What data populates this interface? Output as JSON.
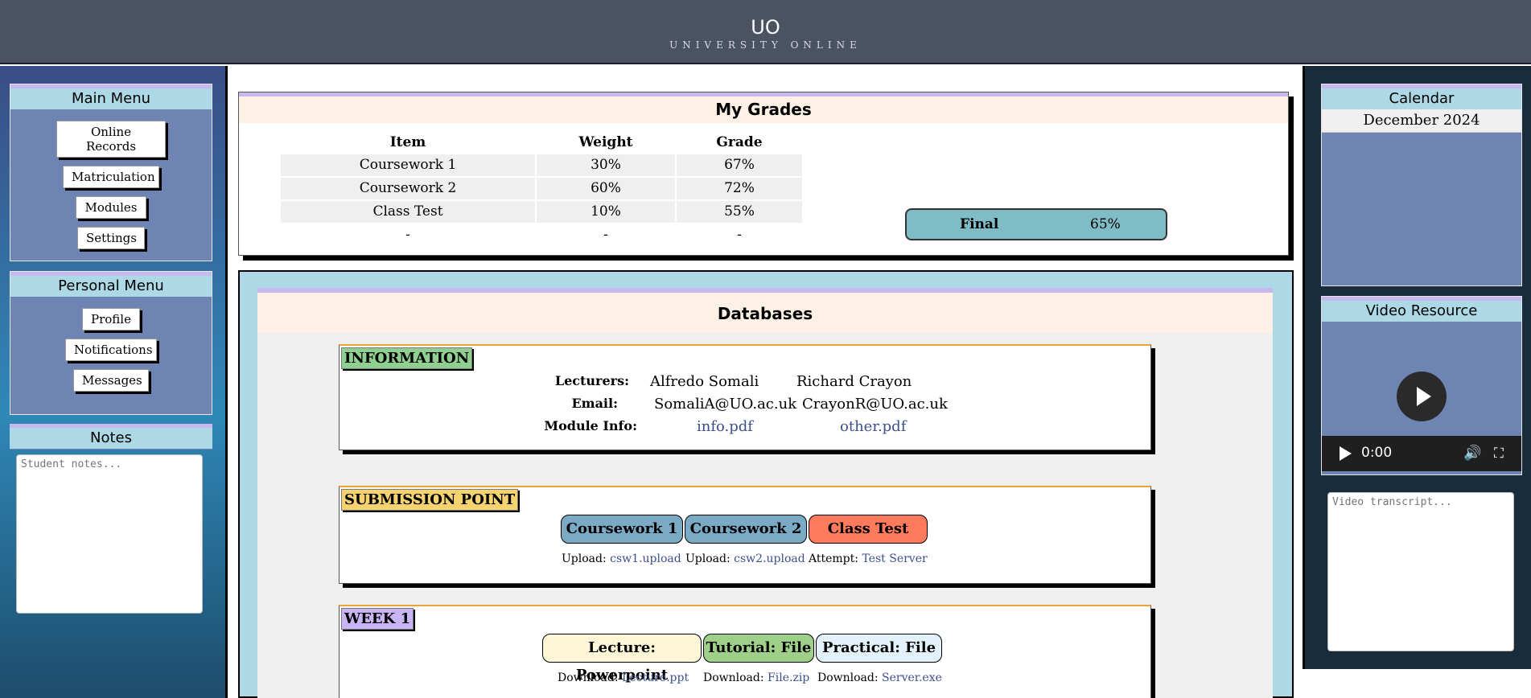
{
  "header": {
    "logo": "UO",
    "tagline": "UNIVERSITY ONLINE"
  },
  "main_menu": {
    "title": "Main Menu",
    "items": [
      "Online Records",
      "Matriculation",
      "Modules",
      "Settings"
    ]
  },
  "personal_menu": {
    "title": "Personal Menu",
    "items": [
      "Profile",
      "Notifications",
      "Messages"
    ]
  },
  "notes": {
    "title": "Notes",
    "placeholder": "Student notes..."
  },
  "calendar": {
    "title": "Calendar",
    "month": "December 2024"
  },
  "video": {
    "title": "Video Resource",
    "time": "0:00",
    "transcript_placeholder": "Video transcript..."
  },
  "grades": {
    "title": "My Grades",
    "headers": [
      "Item",
      "Weight",
      "Grade"
    ],
    "rows": [
      [
        "Coursework 1",
        "30%",
        "67%"
      ],
      [
        "Coursework 2",
        "60%",
        "72%"
      ],
      [
        "Class Test",
        "10%",
        "55%"
      ],
      [
        "-",
        "-",
        "-"
      ]
    ],
    "final_label": "Final",
    "final_value": "65%"
  },
  "databases": {
    "title": "Databases",
    "information": {
      "label": "INFORMATION",
      "lecturers_label": "Lecturers:",
      "email_label": "Email:",
      "module_info_label": "Module Info:",
      "lecturers": [
        "Alfredo Somali",
        "Richard Crayon"
      ],
      "emails": [
        "SomaliA@UO.ac.uk",
        "CrayonR@UO.ac.uk"
      ],
      "files": [
        "info.pdf",
        "other.pdf"
      ]
    },
    "submission": {
      "label": "SUBMISSION POINT",
      "buttons": [
        "Coursework 1",
        "Coursework 2",
        "Class Test"
      ],
      "actions": [
        {
          "prefix": "Upload:",
          "link": "csw1.upload"
        },
        {
          "prefix": "Upload:",
          "link": "csw2.upload"
        },
        {
          "prefix": "Attempt:",
          "link": "Test Server"
        }
      ]
    },
    "week1": {
      "label": "WEEK 1",
      "buttons": [
        "Lecture: Powerpoint",
        "Tutorial: File",
        "Practical: File"
      ],
      "actions": [
        {
          "prefix": "Download:",
          "link": "Lecture.ppt"
        },
        {
          "prefix": "Download:",
          "link": "File.zip"
        },
        {
          "prefix": "Download:",
          "link": "Server.exe"
        }
      ]
    }
  },
  "colors": {
    "header_bg": "#4b5262",
    "panel_title_bg": "#add8e6",
    "panel_bg": "#6e84b2",
    "accent_purple": "#c8b8f0",
    "final_bg": "#7fbcc6",
    "coursework_btn": "#7aaac4",
    "class_test_btn": "#ff7b5c",
    "lecture_btn": "#fff6d8",
    "tutorial_btn": "#9fd08a",
    "practical_btn": "#e3f1fb"
  }
}
